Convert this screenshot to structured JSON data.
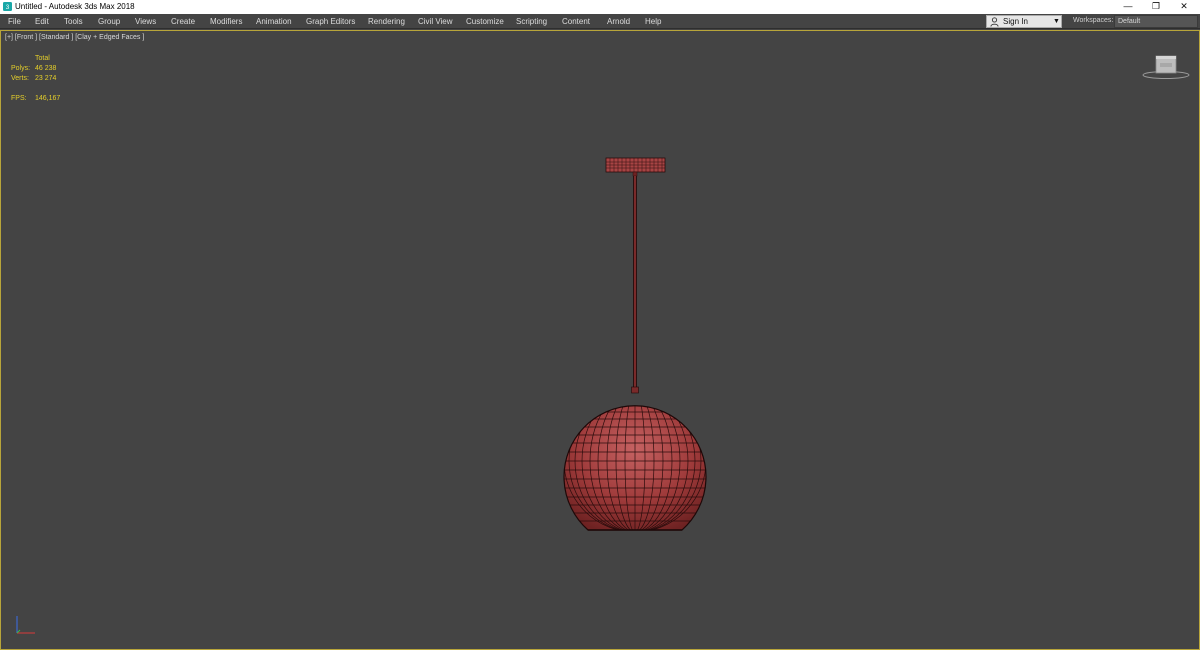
{
  "window": {
    "title": "Untitled - Autodesk 3ds Max 2018",
    "controls": {
      "minimize": "—",
      "maximize": "❐",
      "close": "✕"
    }
  },
  "menu": {
    "items": [
      "File",
      "Edit",
      "Tools",
      "Group",
      "Views",
      "Create",
      "Modifiers",
      "Animation",
      "Graph Editors",
      "Rendering",
      "Civil View",
      "Customize",
      "Scripting",
      "Content",
      "Arnold",
      "Help"
    ],
    "sign_in": "Sign In",
    "workspaces_label": "Workspaces:",
    "workspaces_value": "Default"
  },
  "viewport": {
    "label": "[+] [Front ] [Standard ] [Clay + Edged Faces ]",
    "stats": {
      "header": "Total",
      "polys_label": "Polys:",
      "polys_value": "46 238",
      "verts_label": "Verts:",
      "verts_value": "23 274",
      "fps_label": "FPS:",
      "fps_value": "146,167"
    }
  },
  "colors": {
    "viewport_bg": "#444444",
    "stats_text": "#e5cf2a",
    "model_clay": "#9e3a3a",
    "model_edges": "#2a0c0c",
    "viewport_border": "#b8a53a"
  },
  "icons": {
    "app": "3dsmax-app-icon",
    "user": "user-icon",
    "viewcube": "viewcube-icon",
    "axis": "axis-tripod-icon"
  }
}
